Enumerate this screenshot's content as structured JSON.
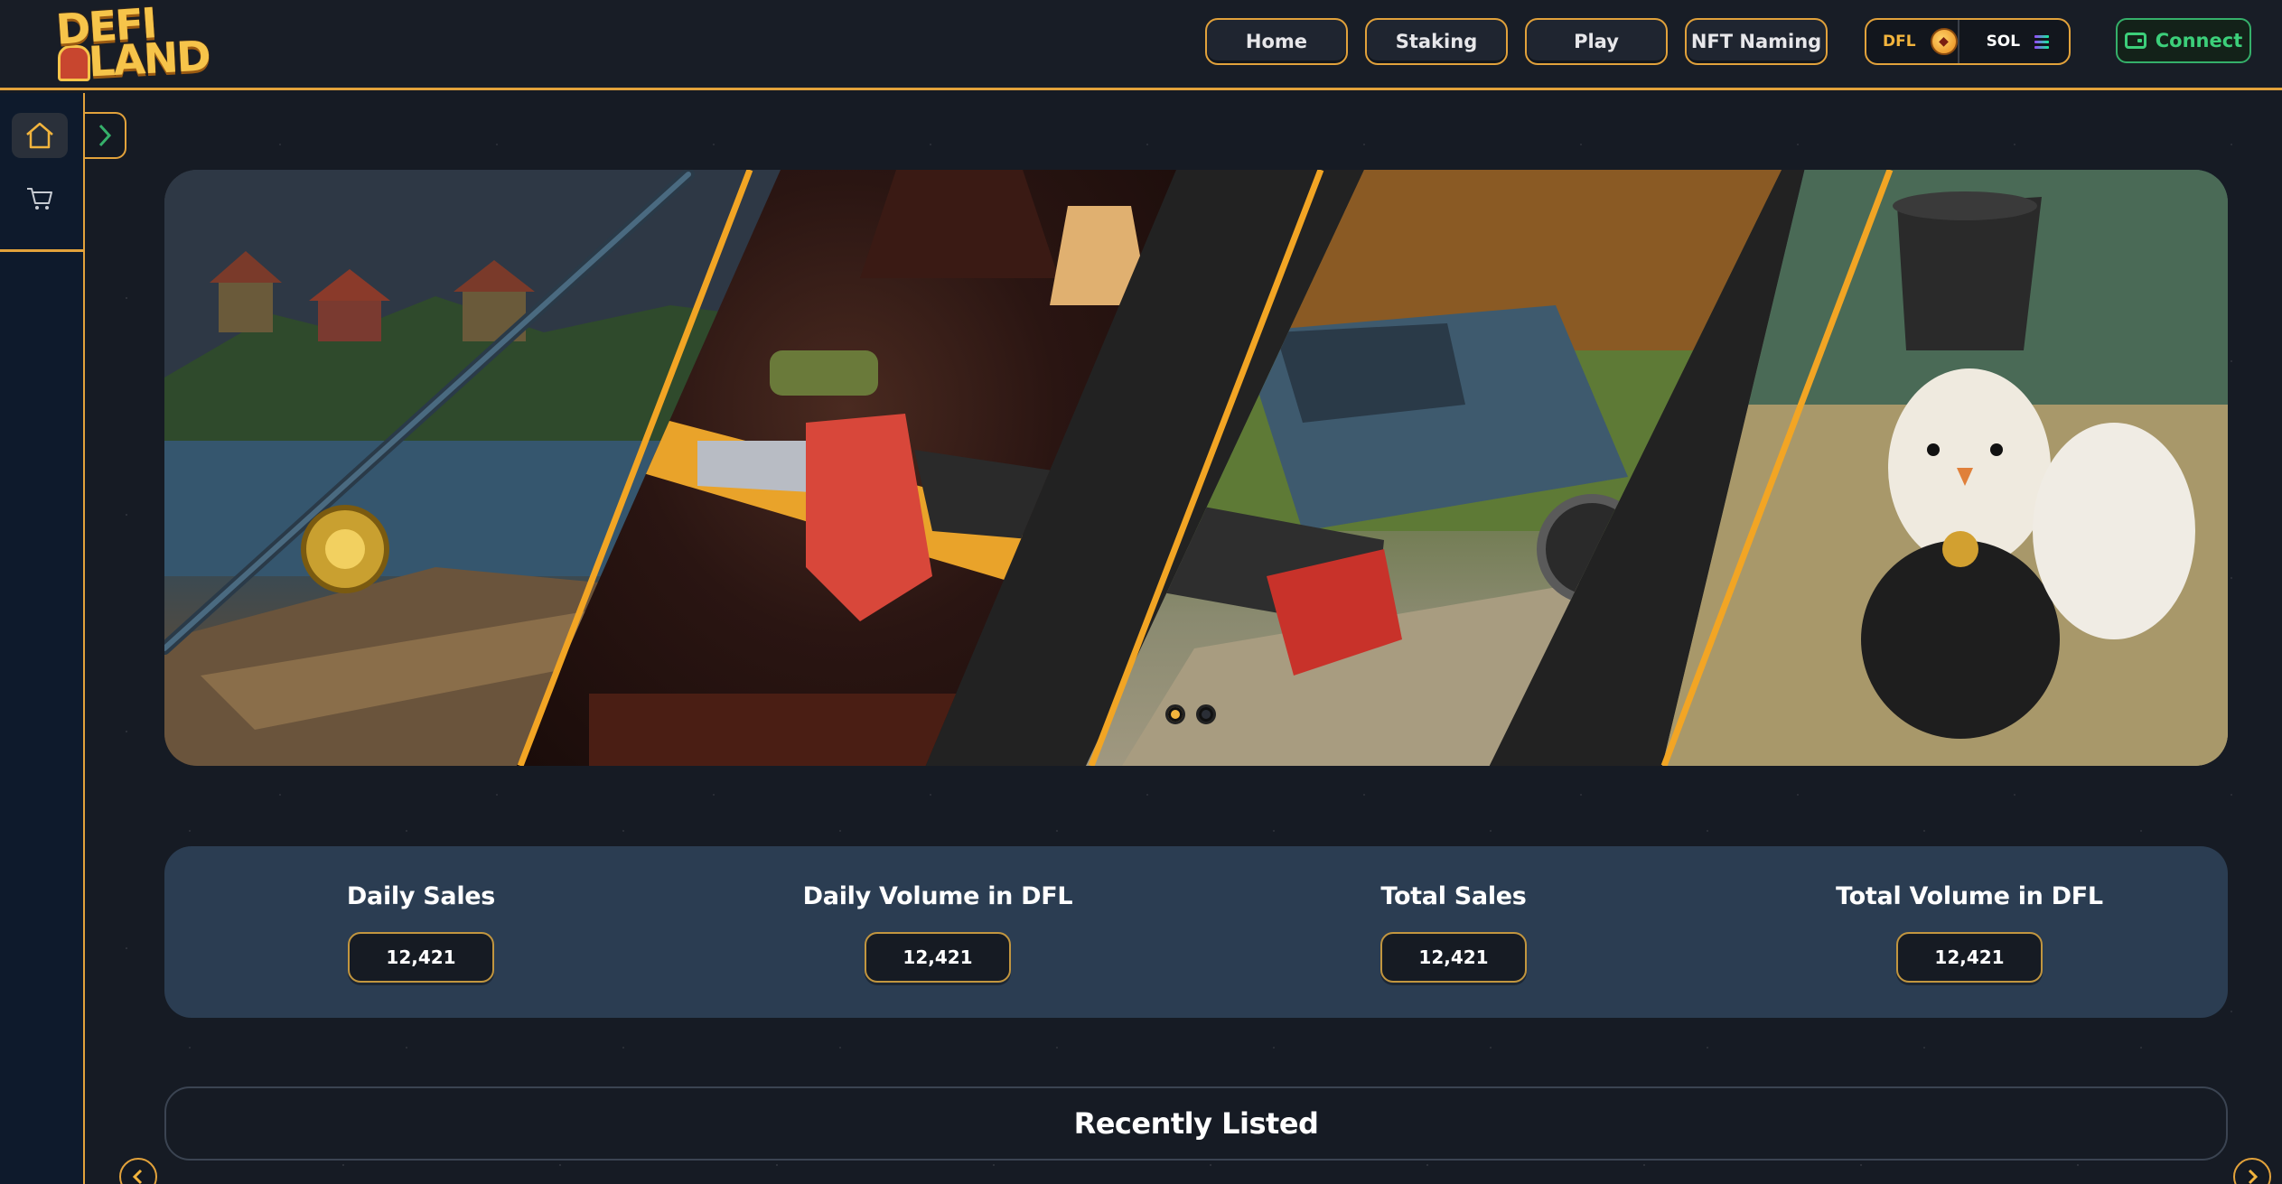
{
  "brand": {
    "logo_line1": "DEFI",
    "logo_line2": "LAND"
  },
  "nav": {
    "items": [
      {
        "label": "Home"
      },
      {
        "label": "Staking"
      },
      {
        "label": "Play"
      },
      {
        "label": "NFT Naming"
      }
    ]
  },
  "tokens": {
    "dfl_label": "DFL",
    "sol_label": "SOL"
  },
  "connect": {
    "label": "Connect"
  },
  "carousel": {
    "slide_count": 2,
    "active_index": 0
  },
  "stats": [
    {
      "label": "Daily Sales",
      "value": "12,421"
    },
    {
      "label": "Daily Volume in DFL",
      "value": "12,421"
    },
    {
      "label": "Total Sales",
      "value": "12,421"
    },
    {
      "label": "Total Volume in DFL",
      "value": "12,421"
    }
  ],
  "recent": {
    "title": "Recently Listed"
  },
  "colors": {
    "accent": "#e2a23b",
    "connect_green": "#3ccf7a",
    "stats_bg": "#2b3d52",
    "sidebar_bg": "#0e1a2c"
  },
  "icons": {
    "sidebar": [
      "home-icon",
      "cart-icon"
    ],
    "toggle": "chevron-right-icon",
    "connect": "wallet-icon",
    "slider_prev": "chevron-left-icon",
    "slider_next": "chevron-right-icon"
  }
}
